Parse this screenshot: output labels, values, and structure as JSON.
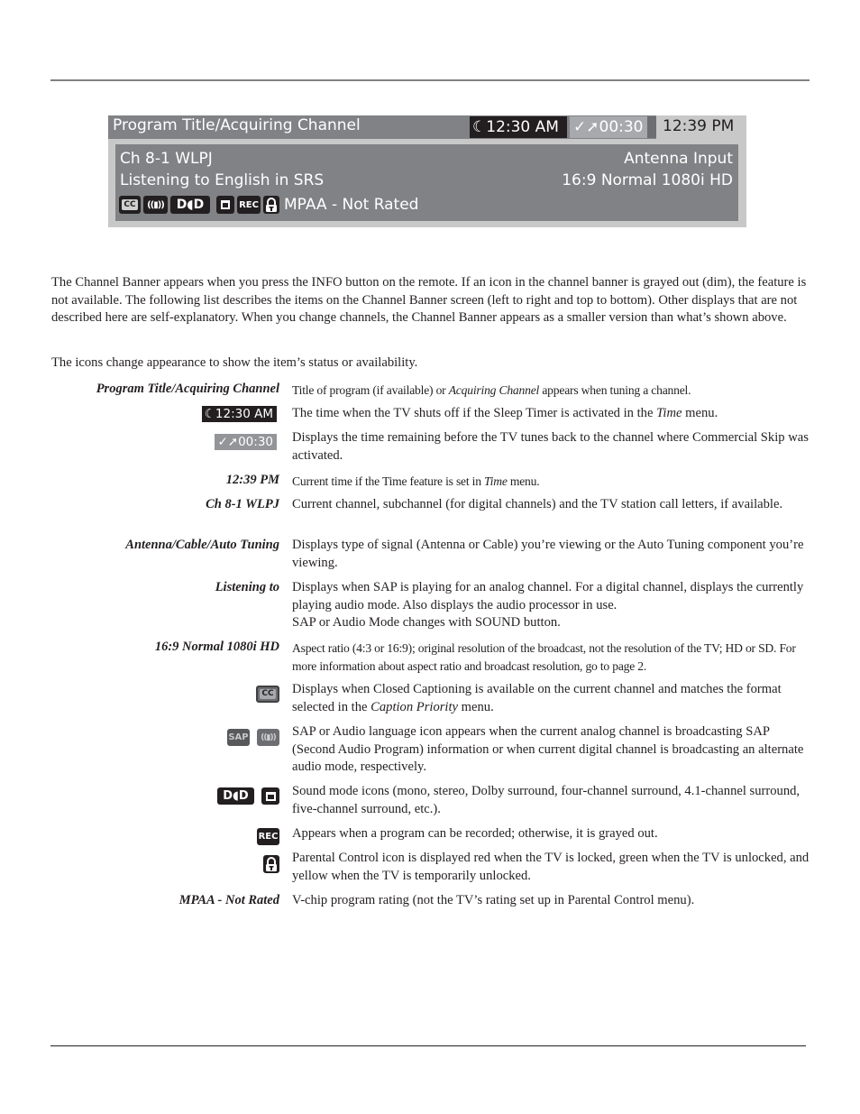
{
  "banner": {
    "title": "Program Title/Acquiring Channel",
    "sleep_timer": "12:30 AM",
    "commercial_skip": "00:30",
    "clock": "12:39 PM",
    "channel": "Ch 8-1 WLPJ",
    "listening": "Listening to English in SRS",
    "input": "Antenna Input",
    "format": "16:9 Normal 1080i HD",
    "icons": {
      "cc": "CC",
      "audio": "((▮))",
      "dolby": "D◖D",
      "rec": "REC"
    },
    "rating": "MPAA - Not Rated"
  },
  "intro": {
    "paragraph1": "The Channel Banner appears when you press the INFO button on the remote. If an icon in the channel banner is grayed out (dim), the feature is not available. The following list describes the items on the Channel Banner screen (left to right and top to bottom). Other displays that are not described here are self-explanatory. When you change channels, the Channel Banner appears as a smaller version than what’s shown above.",
    "paragraph2": "The icons change appearance to show the item’s status or availability."
  },
  "definitions": [
    {
      "term": "Program Title/Acquiring Channel",
      "pre": "Title of program (if available) or ",
      "em": "Acquiring Channel",
      "post": " appears when tuning a channel."
    },
    {
      "term": "12:30 AM",
      "pre": "The time when the TV shuts off if the Sleep Timer is activated in the ",
      "em": "Time",
      "post": " menu."
    },
    {
      "term": "00:30",
      "text": "Displays the time remaining before the TV tunes back to the channel where Commercial Skip was activated."
    },
    {
      "term": "12:39 PM",
      "pre": "Current time if the Time feature is set in ",
      "em": "Time",
      "post": " menu."
    },
    {
      "term": "Ch 8-1 WLPJ",
      "text": "Current channel, subchannel (for digital channels) and the TV station call letters, if available."
    },
    {
      "term": "Antenna/Cable/Auto Tuning",
      "text": "Displays type of signal (Antenna or Cable) you’re viewing or the Auto Tuning component you’re viewing."
    },
    {
      "term": "Listening to",
      "text": "Displays when SAP is playing for an analog channel. For a digital channel, displays the currently playing audio mode. Also displays the audio processor in use.",
      "text2": "SAP or Audio Mode changes with SOUND button."
    },
    {
      "term": "16:9 Normal 1080i HD",
      "text": "Aspect ratio (4:3 or 16:9); original resolution of the broadcast, not the resolution of the TV; HD or SD. For more information about aspect ratio and broadcast resolution, go to page 2."
    },
    {
      "icon": "cc",
      "pre": "Displays when Closed Captioning is available on the current channel and matches the format selected in the ",
      "em": "Caption Priority",
      "post": " menu."
    },
    {
      "icon": "sap",
      "icon_label": "SAP",
      "text": "SAP or Audio language icon appears when the current analog channel is broadcasting SAP (Second Audio Program) information or when current digital channel is broadcasting an alternate audio mode, respectively."
    },
    {
      "icon": "sound-mode",
      "text": "Sound mode icons (mono, stereo, Dolby surround, four-channel surround, 4.1-channel surround, five-channel surround, etc.)."
    },
    {
      "icon": "rec",
      "text": "Appears when a program can be recorded; otherwise, it is grayed out."
    },
    {
      "icon": "lock",
      "text": "Parental Control icon is displayed red when the TV is locked, green when the TV is unlocked, and yellow when the TV is temporarily unlocked."
    },
    {
      "term": "MPAA - Not Rated",
      "text": "V-chip program rating (not the TV’s rating set up in Parental Control menu)."
    }
  ]
}
